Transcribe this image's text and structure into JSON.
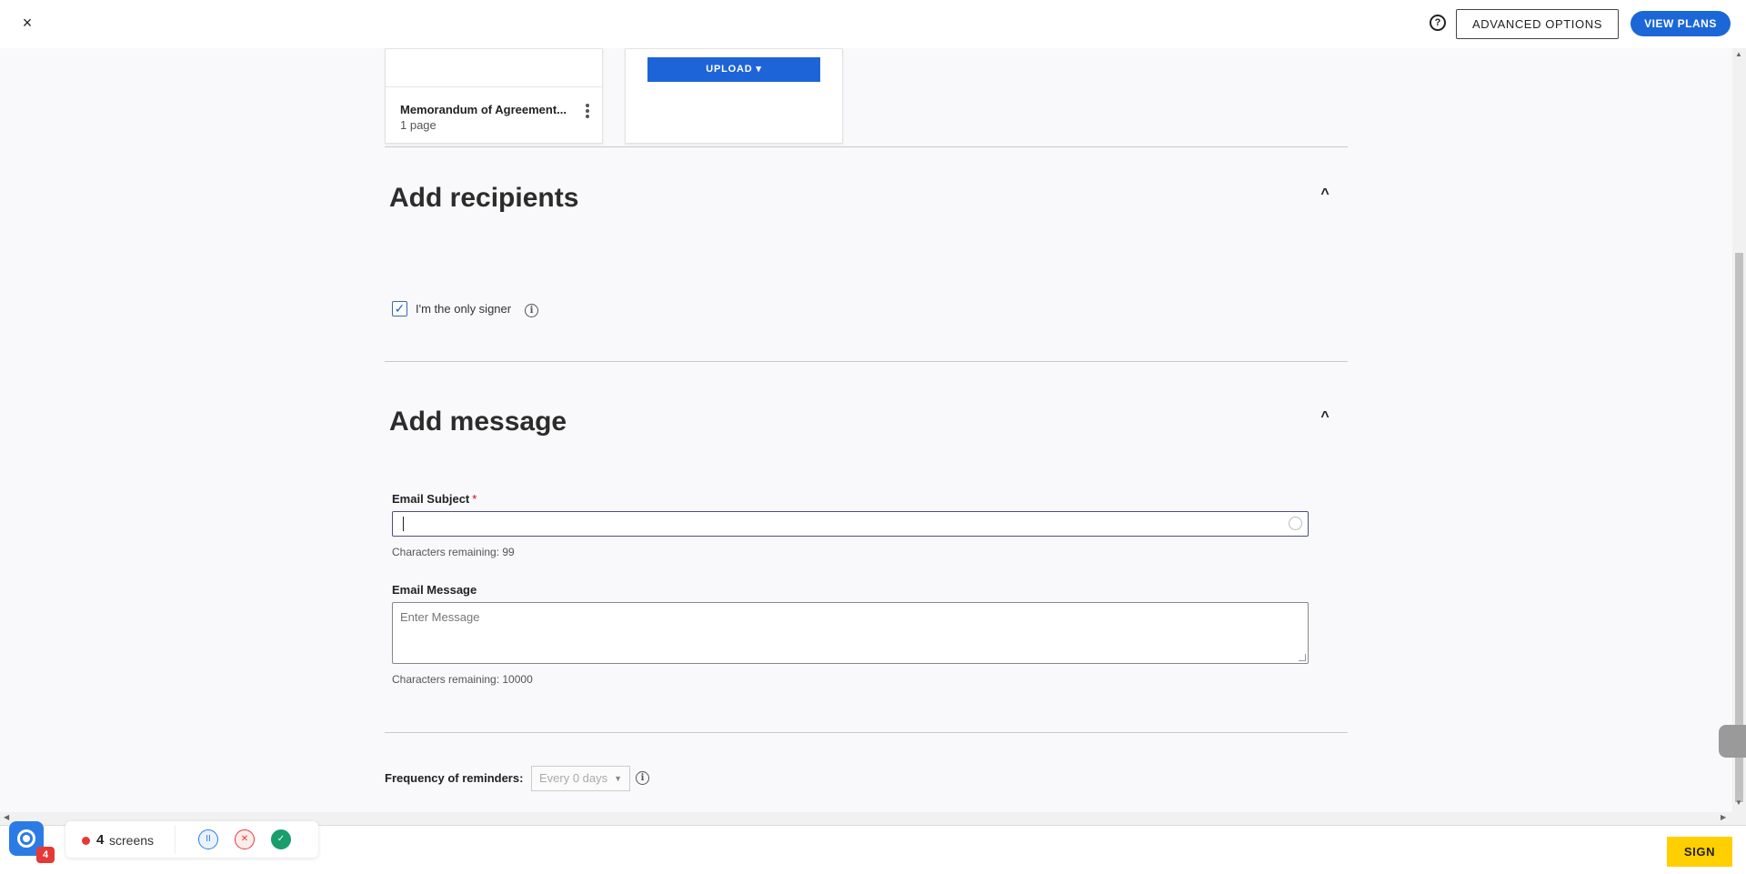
{
  "topbar": {
    "close_icon": "×",
    "help_icon": "?",
    "advanced_options": "ADVANCED OPTIONS",
    "view_plans": "VIEW PLANS"
  },
  "documents": {
    "card": {
      "title": "Memorandum of Agreement...",
      "pages": "1 page"
    },
    "upload_label": "UPLOAD ▾"
  },
  "recipients": {
    "title": "Add recipients",
    "only_signer_label": "I'm the only signer",
    "only_signer_checked": true,
    "info_icon": "i"
  },
  "message": {
    "title": "Add message",
    "subject_label": "Email Subject",
    "subject_required": "*",
    "subject_value": "",
    "subject_remaining": "Characters remaining: 99",
    "message_label": "Email Message",
    "message_placeholder": "Enter Message",
    "message_remaining": "Characters remaining: 10000"
  },
  "reminders": {
    "label": "Frequency of reminders:",
    "selected": "Every 0 days",
    "info_icon": "i"
  },
  "footer": {
    "sign": "SIGN"
  },
  "recorder": {
    "badge": "4",
    "count": "4",
    "label": "screens",
    "colors": {
      "pause": "#2c7be5",
      "cancel": "#e53935",
      "done": "#1a9d6c"
    }
  },
  "colors": {
    "primary_blue": "#1b67d8",
    "sign_yellow": "#ffcf00",
    "background": "#f9f8fa"
  }
}
